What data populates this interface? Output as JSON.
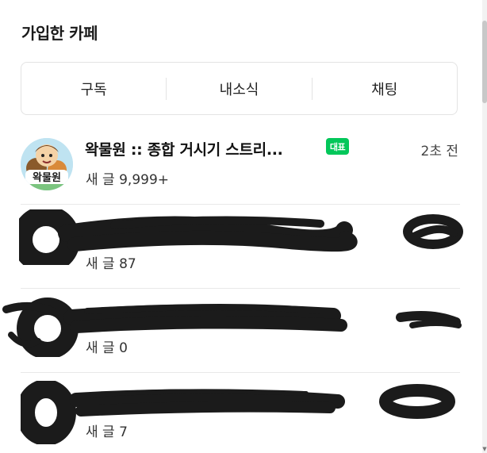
{
  "header": {
    "title": "가입한 카페"
  },
  "tabs": [
    {
      "label": "구독"
    },
    {
      "label": "내소식"
    },
    {
      "label": "채팅"
    }
  ],
  "cafes": [
    {
      "name": "왁물원 :: 종합 거시기 스트리...",
      "badge": "대표",
      "time": "2초 전",
      "new_posts_label": "새 글",
      "new_posts_count": "9,999+",
      "avatar_icon": "cafe-avatar-image",
      "redacted": false
    },
    {
      "name": "",
      "time": "",
      "new_posts_label": "새 글",
      "new_posts_count": "87",
      "redacted": true
    },
    {
      "name": "",
      "time": "",
      "new_posts_label": "새 글",
      "new_posts_count": "0",
      "redacted": true
    },
    {
      "name": "",
      "time": "",
      "new_posts_label": "새 글",
      "new_posts_count": "7",
      "redacted": true
    }
  ],
  "colors": {
    "badge_green": "#03c75a",
    "border": "#e3e3e3",
    "redaction": "#1b1b1b"
  }
}
